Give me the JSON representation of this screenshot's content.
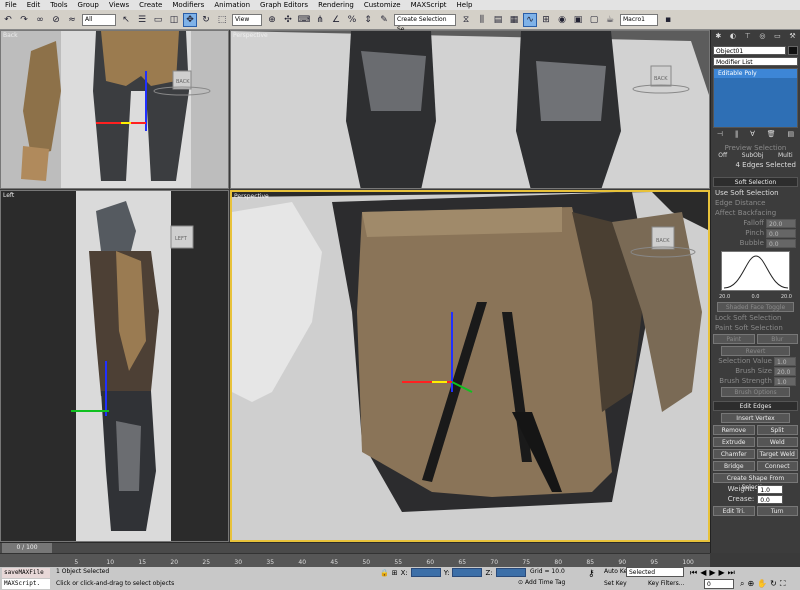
{
  "menu": [
    "File",
    "Edit",
    "Tools",
    "Group",
    "Views",
    "Create",
    "Modifiers",
    "Animation",
    "Graph Editors",
    "Rendering",
    "Customize",
    "MAXScript",
    "Help"
  ],
  "toolbar": {
    "filter": "All",
    "view": "View",
    "selection_set": "Create Selection Se",
    "macro": "Macro1"
  },
  "viewports": {
    "top_left": "Back",
    "top_right": "Perspective",
    "bottom_left": "Left",
    "bottom_right": "Perspective",
    "cube_back": "BACK",
    "cube_left": "LEFT"
  },
  "command_panel": {
    "object_name": "Object01",
    "modifier_list": "Modifier List",
    "stack_item": "Editable Poly",
    "preview_selection": {
      "title": "Preview Selection",
      "options": [
        "Off",
        "SubObj",
        "Multi"
      ],
      "status": "4 Edges Selected"
    },
    "soft_selection": {
      "title": "Soft Selection",
      "use": "Use Soft Selection",
      "edge_distance": "Edge Distance",
      "affect_backfacing": "Affect Backfacing",
      "falloff_label": "Falloff",
      "falloff": "20.0",
      "pinch_label": "Pinch",
      "pinch": "0.0",
      "bubble_label": "Bubble",
      "bubble": "0.0",
      "curve_ticks": [
        "20.0",
        "0.0",
        "20.0"
      ],
      "shaded_face_toggle": "Shaded Face Toggle",
      "lock_soft": "Lock Soft Selection",
      "paint_title": "Paint Soft Selection",
      "paint": "Paint",
      "blur": "Blur",
      "revert": "Revert",
      "sel_value": "Selection Value",
      "sel_value_val": "1.0",
      "brush_size": "Brush Size",
      "brush_size_val": "20.0",
      "brush_strength": "Brush Strength",
      "brush_strength_val": "1.0",
      "brush_options": "Brush Options"
    },
    "edit_edges": {
      "title": "Edit Edges",
      "insert_vertex": "Insert Vertex",
      "remove": "Remove",
      "split": "Split",
      "extrude": "Extrude",
      "weld": "Weld",
      "chamfer": "Chamfer",
      "target_weld": "Target Weld",
      "bridge": "Bridge",
      "connect": "Connect",
      "create_shape": "Create Shape From Selection",
      "weight_label": "Weight:",
      "weight": "1.0",
      "crease_label": "Crease:",
      "crease": "0.0",
      "edit_tri": "Edit Tri.",
      "turn": "Turn"
    }
  },
  "timeline": {
    "frame": "0 / 100",
    "ticks": [
      "5",
      "10",
      "15",
      "20",
      "25",
      "30",
      "35",
      "40",
      "45",
      "50",
      "55",
      "60",
      "65",
      "70",
      "75",
      "80",
      "85",
      "90",
      "95",
      "100"
    ]
  },
  "status": {
    "script1": "saveMAXFile",
    "script2": "MAXScript.",
    "selected": "1 Object Selected",
    "prompt": "Click or click-and-drag to select objects",
    "x": "X:",
    "y": "Y:",
    "z": "Z:",
    "grid": "Grid = 10.0",
    "add_time_tag": "Add Time Tag",
    "auto_key": "Auto Key",
    "auto_key_mode": "Selected",
    "set_key": "Set Key",
    "key_filters": "Key Filters...",
    "frame_field": "0"
  }
}
